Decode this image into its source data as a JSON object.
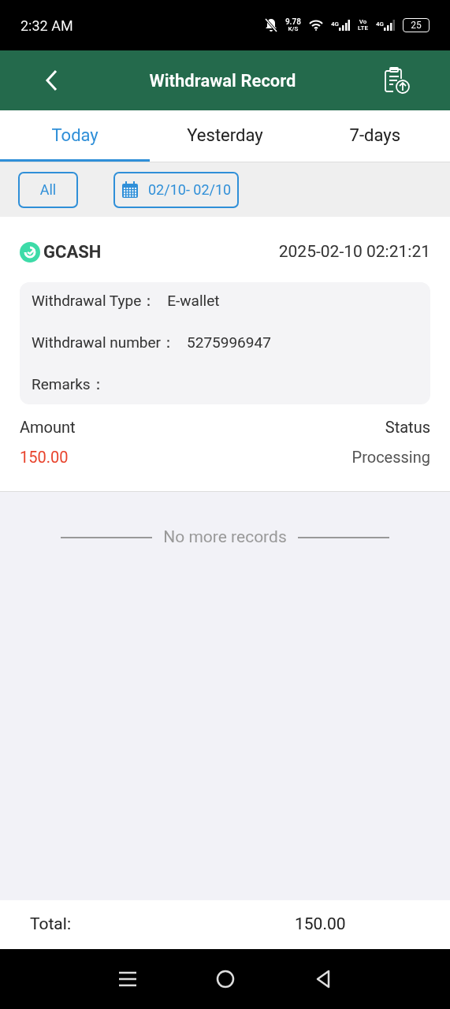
{
  "status_bar": {
    "time": "2:32 AM",
    "net_speed": "9.78",
    "net_unit": "K/S",
    "sim1": "4G",
    "volte_top": "Vo",
    "volte_bottom": "LTE",
    "sim2": "4G",
    "battery": "25"
  },
  "header": {
    "title": "Withdrawal Record"
  },
  "tabs": [
    {
      "label": "Today",
      "selected": true
    },
    {
      "label": "Yesterday",
      "selected": false
    },
    {
      "label": "7-days",
      "selected": false
    }
  ],
  "filters": {
    "type": "All",
    "date_range": "02/10- 02/10"
  },
  "records": [
    {
      "method": "GCASH",
      "time": "2025-02-10 02:21:21",
      "details": [
        {
          "label": "Withdrawal Type：",
          "value": "E-wallet"
        },
        {
          "label": "Withdrawal number：",
          "value": "5275996947"
        },
        {
          "label": "Remarks："
        }
      ],
      "amount_label": "Amount",
      "amount": "150.00",
      "status_label": "Status",
      "status": "Processing"
    }
  ],
  "end_message": "No more records",
  "footer": {
    "label": "Total:",
    "value": "150.00"
  }
}
